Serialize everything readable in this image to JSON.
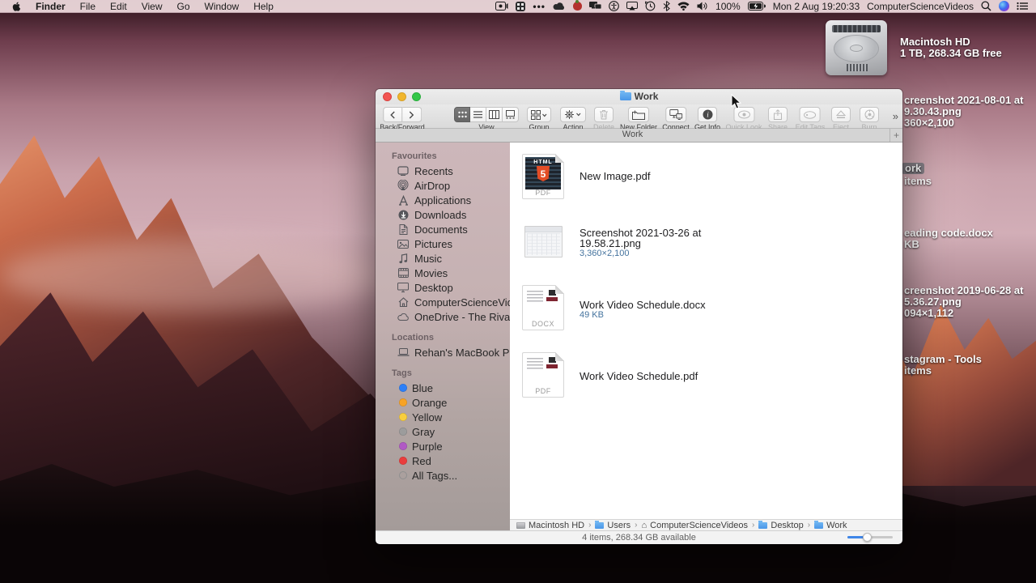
{
  "menu_bar": {
    "app_menus": [
      "Finder",
      "File",
      "Edit",
      "View",
      "Go",
      "Window",
      "Help"
    ],
    "more_dots": "•••",
    "battery_percent": "100%",
    "clock": "Mon 2 Aug 19:20:33",
    "account_name": "ComputerScienceVideos",
    "status_icons": [
      "screen-recording",
      "grid-app",
      "more-dots",
      "cloud",
      "red-app",
      "displays",
      "accessibility",
      "airplay",
      "time-machine",
      "bluetooth",
      "wifi",
      "volume",
      "battery-charging",
      "search",
      "siri",
      "notification-center"
    ]
  },
  "desktop": {
    "hd_name": "Macintosh HD",
    "hd_info": "1 TB, 268.34 GB free",
    "fragments": {
      "shot2021": {
        "line1": "creenshot 2021-08-01 at",
        "line2": "9.30.43.png",
        "line3": "360×2,100"
      },
      "work_chip": {
        "name": "ork",
        "sub": "items"
      },
      "reading": {
        "line1": "eading code.docx",
        "line2": "KB"
      },
      "shot2019": {
        "line1": "creenshot 2019-06-28 at",
        "line2": "5.36.27.png",
        "line3": "094×1,112"
      },
      "instagram": {
        "line1": "stagram - Tools",
        "line2": "items"
      }
    }
  },
  "window": {
    "title": "Work",
    "tab_title": "Work",
    "new_tab": "+",
    "overflow": "»",
    "toolbar": {
      "back_forward_label": "Back/Forward",
      "view_label": "View",
      "group_label": "Group",
      "action_label": "Action",
      "delete_label": "Delete",
      "new_folder_label": "New Folder",
      "connect_label": "Connect",
      "get_info_label": "Get Info",
      "quick_look_label": "Quick Look",
      "share_label": "Share",
      "edit_tags_label": "Edit Tags",
      "eject_label": "Eject",
      "burn_label": "Burn"
    },
    "sidebar": {
      "favourites_header": "Favourites",
      "favourites": [
        {
          "label": "Recents",
          "icon": "recents-icon"
        },
        {
          "label": "AirDrop",
          "icon": "airdrop-icon"
        },
        {
          "label": "Applications",
          "icon": "applications-icon"
        },
        {
          "label": "Downloads",
          "icon": "downloads-icon"
        },
        {
          "label": "Documents",
          "icon": "documents-icon"
        },
        {
          "label": "Pictures",
          "icon": "pictures-icon"
        },
        {
          "label": "Music",
          "icon": "music-icon"
        },
        {
          "label": "Movies",
          "icon": "movies-icon"
        },
        {
          "label": "Desktop",
          "icon": "desktop-icon"
        },
        {
          "label": "ComputerScienceVideos",
          "icon": "home-icon"
        },
        {
          "label": "OneDrive - The Rival",
          "icon": "cloud-icon"
        }
      ],
      "locations_header": "Locations",
      "locations": [
        {
          "label": "Rehan's MacBook Pro",
          "icon": "laptop-icon"
        }
      ],
      "tags_header": "Tags",
      "tags": [
        {
          "label": "Blue",
          "color": "#2d7ff7"
        },
        {
          "label": "Orange",
          "color": "#f7a325"
        },
        {
          "label": "Yellow",
          "color": "#f8ce3d"
        },
        {
          "label": "Gray",
          "color": "#9c9c9c"
        },
        {
          "label": "Purple",
          "color": "#b05ac4"
        },
        {
          "label": "Red",
          "color": "#ea3d3d"
        },
        {
          "label": "All Tags...",
          "color": "ring"
        }
      ]
    },
    "files": [
      {
        "name": "New Image.pdf",
        "badge": "PDF",
        "icon_text_top": "HTML",
        "icon_text_big": "5"
      },
      {
        "name_line1": "Screenshot 2021-03-26 at",
        "name_line2": "19.58.21.png",
        "meta": "3,360×2,100"
      },
      {
        "name": "Work Video Schedule.docx",
        "meta": "49 KB",
        "badge": "DOCX"
      },
      {
        "name": "Work Video Schedule.pdf",
        "badge": "PDF"
      }
    ],
    "path_bar": [
      "Macintosh HD",
      "Users",
      "ComputerScienceVideos",
      "Desktop",
      "Work"
    ],
    "status_text": "4 items, 268.34 GB available"
  },
  "colors": {
    "meta_text_blue": "#44739e",
    "selection_chip_gray": "#76767c",
    "folder_blue": "#4a97e8"
  }
}
